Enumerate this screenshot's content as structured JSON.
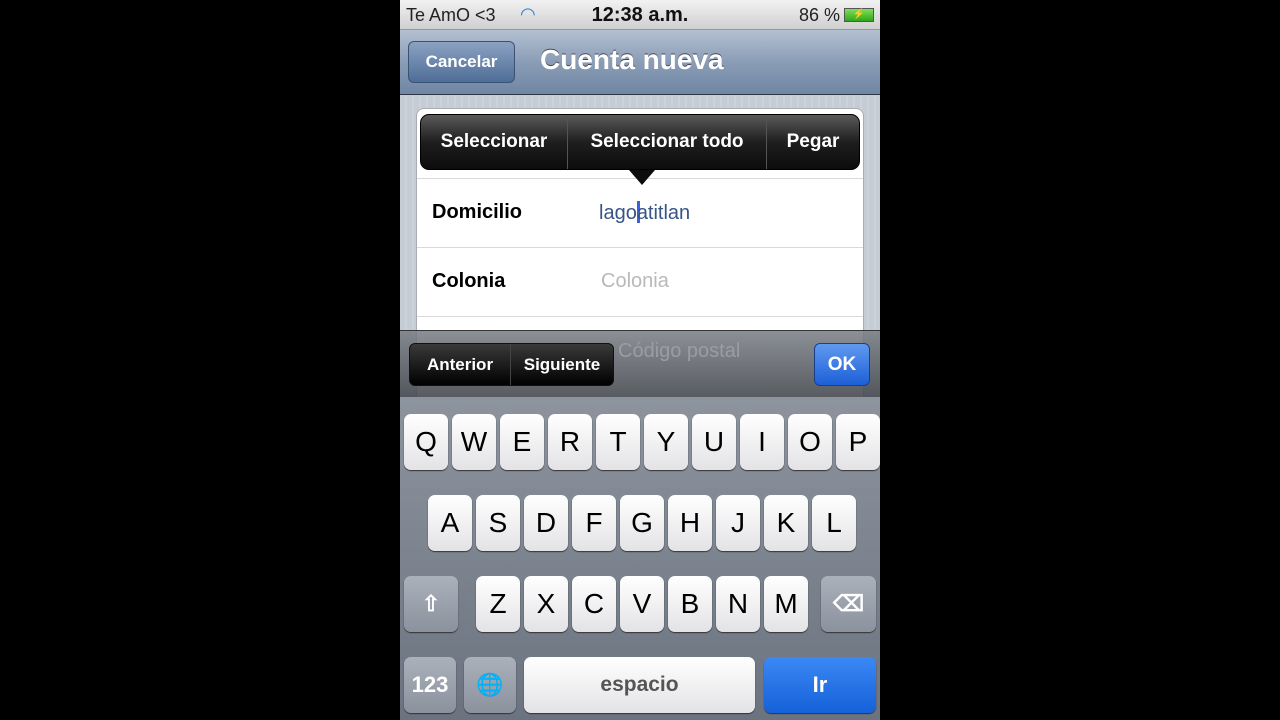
{
  "status": {
    "carrier": "Te AmO <3",
    "time": "12:38 a.m.",
    "battery": "86 %",
    "wifi_icon": "wifi-icon",
    "battery_icon": "battery-charging-icon"
  },
  "nav": {
    "cancel": "Cancelar",
    "title": "Cuenta nueva"
  },
  "edit_menu": {
    "items": [
      "Seleccionar",
      "Seleccionar todo",
      "Pegar"
    ]
  },
  "form": {
    "domicilio": {
      "label": "Domicilio",
      "value_before": "lago",
      "value_after": "atitlan"
    },
    "colonia": {
      "label": "Colonia",
      "placeholder": "Colonia"
    },
    "cp": {
      "placeholder": "Código postal"
    }
  },
  "toolbar": {
    "prev": "Anterior",
    "next": "Siguiente",
    "ok": "OK"
  },
  "keyboard": {
    "row1": [
      "Q",
      "W",
      "E",
      "R",
      "T",
      "Y",
      "U",
      "I",
      "O",
      "P"
    ],
    "row2": [
      "A",
      "S",
      "D",
      "F",
      "G",
      "H",
      "J",
      "K",
      "L"
    ],
    "row3": [
      "Z",
      "X",
      "C",
      "V",
      "B",
      "N",
      "M"
    ],
    "shift": "⇧",
    "delete": "⌫",
    "numbers": "123",
    "globe": "🌐",
    "space": "espacio",
    "go": "Ir"
  },
  "colors": {
    "accent": "#1d5fd6",
    "nav": "#6f86a4"
  }
}
